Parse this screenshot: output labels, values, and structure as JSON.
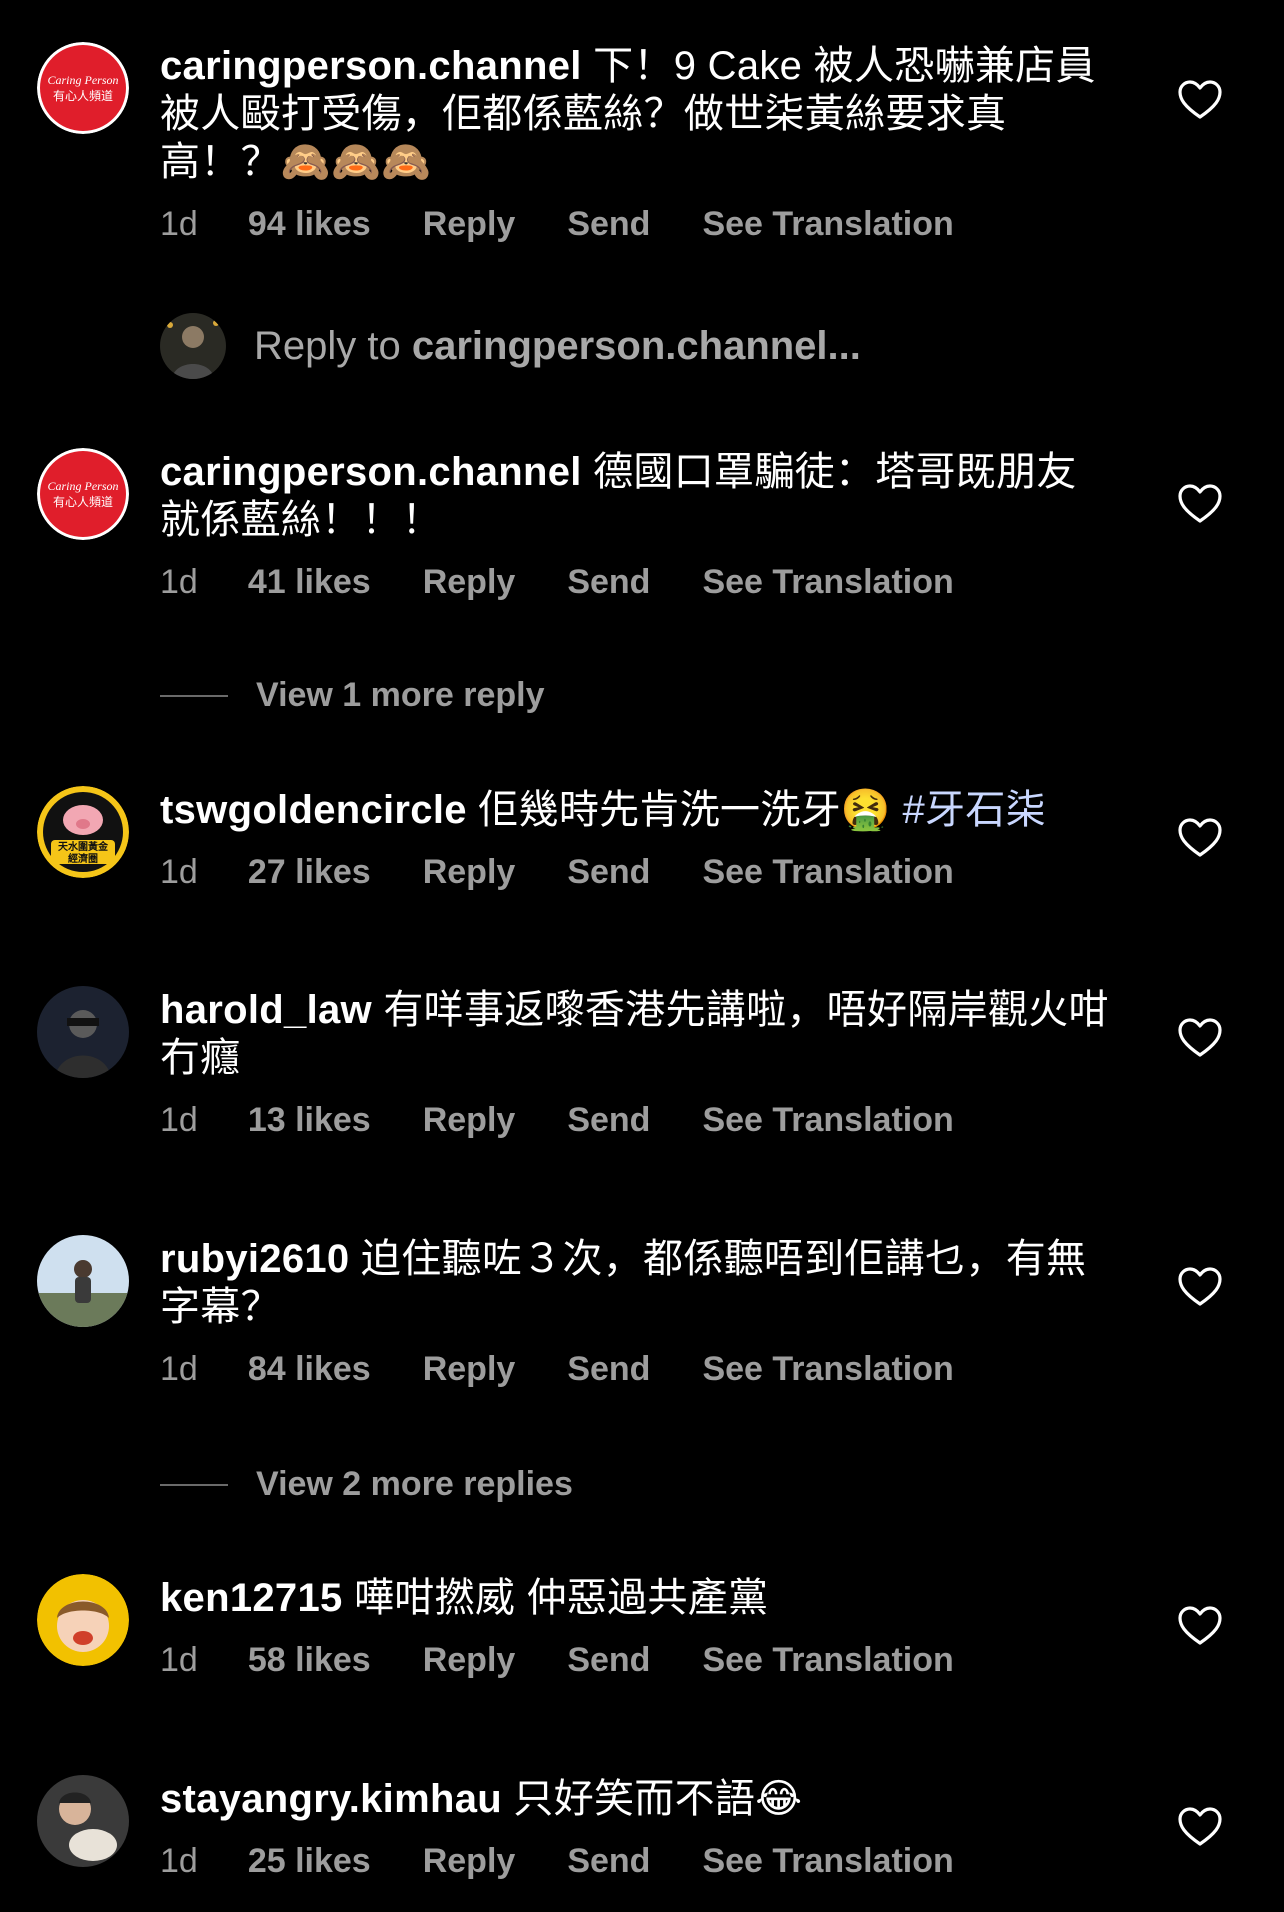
{
  "comments": [
    {
      "username": "caringperson.channel",
      "text": "下！9 Cake 被人恐嚇兼店員被人毆打受傷，佢都係藍絲？做世柒黃絲要求真高！？🙈🙈🙈",
      "time": "1d",
      "likes": "94 likes",
      "reply": "Reply",
      "send": "Send",
      "translate": "See Translation",
      "avatar_text_1": "Caring Person",
      "avatar_text_2": "有心人頻道"
    },
    {
      "username": "caringperson.channel",
      "text": "德國口罩騙徒：塔哥既朋友就係藍絲！！！",
      "time": "1d",
      "likes": "41 likes",
      "reply": "Reply",
      "send": "Send",
      "translate": "See Translation",
      "avatar_text_1": "Caring Person",
      "avatar_text_2": "有心人頻道"
    },
    {
      "username": "tswgoldencircle",
      "text": "佢幾時先肯洗一洗牙🤮",
      "hashtag": "#牙石柒",
      "time": "1d",
      "likes": "27 likes",
      "reply": "Reply",
      "send": "Send",
      "translate": "See Translation",
      "avatar_text_1": "天水圍黃金",
      "avatar_text_2": "經濟圈"
    },
    {
      "username": "harold_law",
      "text": "有咩事返嚟香港先講啦，唔好隔岸觀火咁冇癮",
      "time": "1d",
      "likes": "13 likes",
      "reply": "Reply",
      "send": "Send",
      "translate": "See Translation"
    },
    {
      "username": "rubyi2610",
      "text": "迫住聽咗３次，都係聽唔到佢講乜，有無字幕？",
      "time": "1d",
      "likes": "84 likes",
      "reply": "Reply",
      "send": "Send",
      "translate": "See Translation"
    },
    {
      "username": "ken12715",
      "text": "嘩咁撚威 仲惡過共產黨",
      "time": "1d",
      "likes": "58 likes",
      "reply": "Reply",
      "send": "Send",
      "translate": "See Translation"
    },
    {
      "username": "stayangry.kimhau",
      "text": "只好笑而不語😂",
      "time": "1d",
      "likes": "25 likes",
      "reply": "Reply",
      "send": "Send",
      "translate": "See Translation"
    }
  ],
  "reply_prompt": {
    "prefix": "Reply to",
    "target": "caringperson.channel..."
  },
  "view_more": [
    "View 1 more reply",
    "View 2 more replies"
  ],
  "colors": {
    "background": "#000000",
    "text": "#ffffff",
    "muted": "#9d9d9d",
    "hashtag": "#c9d7ff",
    "brand_red": "#e01e2b"
  },
  "icons": {
    "like": "heart-outline-icon"
  }
}
